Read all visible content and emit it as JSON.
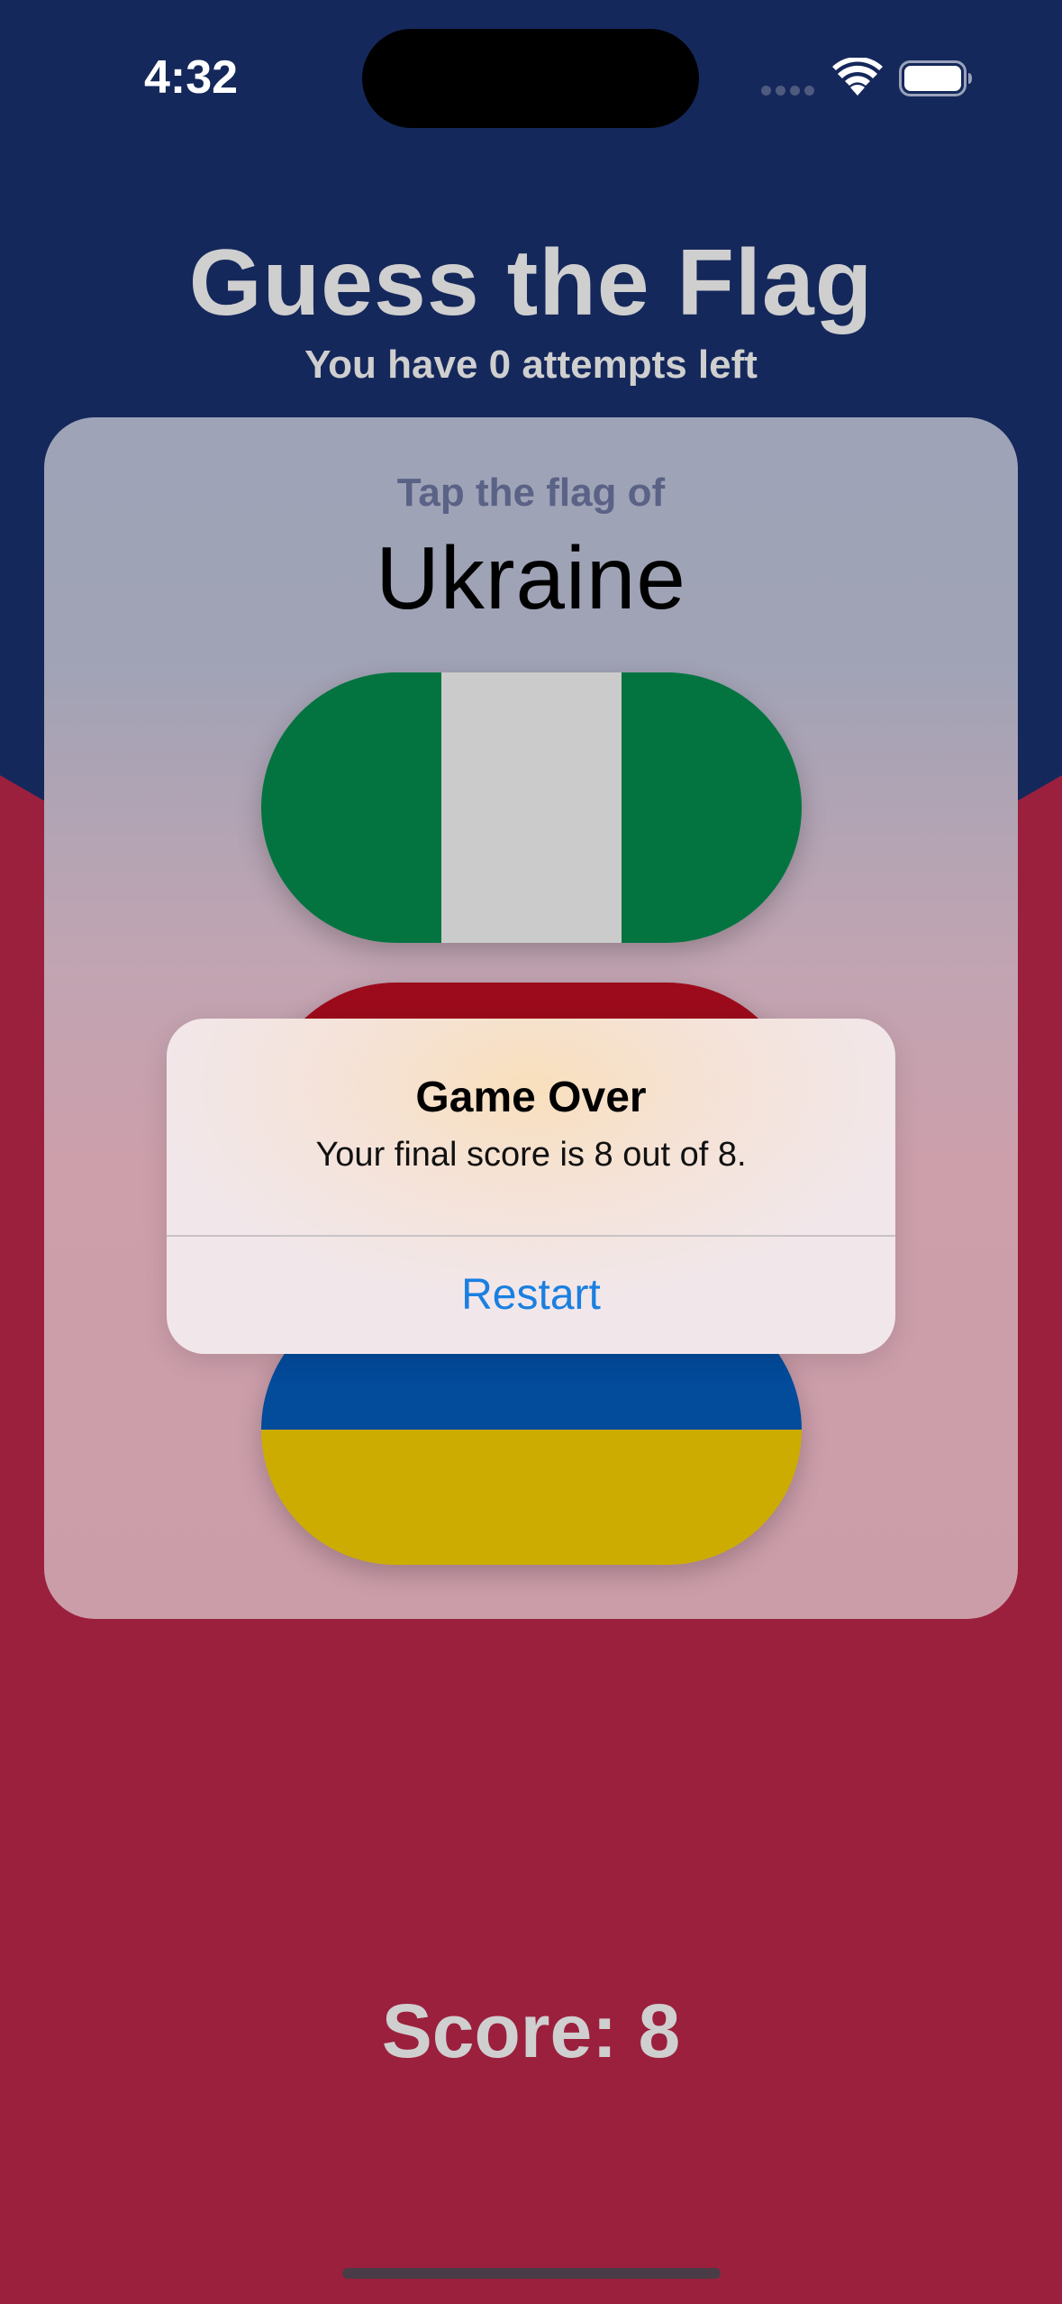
{
  "status_bar": {
    "time": "4:32",
    "icons": [
      "signal-dots-icon",
      "wifi-icon",
      "battery-icon"
    ]
  },
  "header": {
    "title": "Guess the Flag",
    "attempts": "You have 0 attempts left"
  },
  "card": {
    "prompt": "Tap the flag of",
    "country": "Ukraine",
    "flags": [
      {
        "name": "Nigeria",
        "colors": [
          "#037440",
          "#cbcbcb",
          "#037440"
        ]
      },
      {
        "name": "partially hidden red flag",
        "colors": [
          "#9c0b1b"
        ]
      },
      {
        "name": "Ukraine",
        "colors": [
          "#034b9b",
          "#ccac00"
        ]
      }
    ]
  },
  "alert": {
    "title": "Game Over",
    "message": "Your final score is 8 out of 8.",
    "button": "Restart"
  },
  "footer": {
    "score": "Score: 8"
  },
  "colors": {
    "background_top": "#15285b",
    "background_bottom": "#9b203d",
    "accent": "#1a7fe0"
  }
}
